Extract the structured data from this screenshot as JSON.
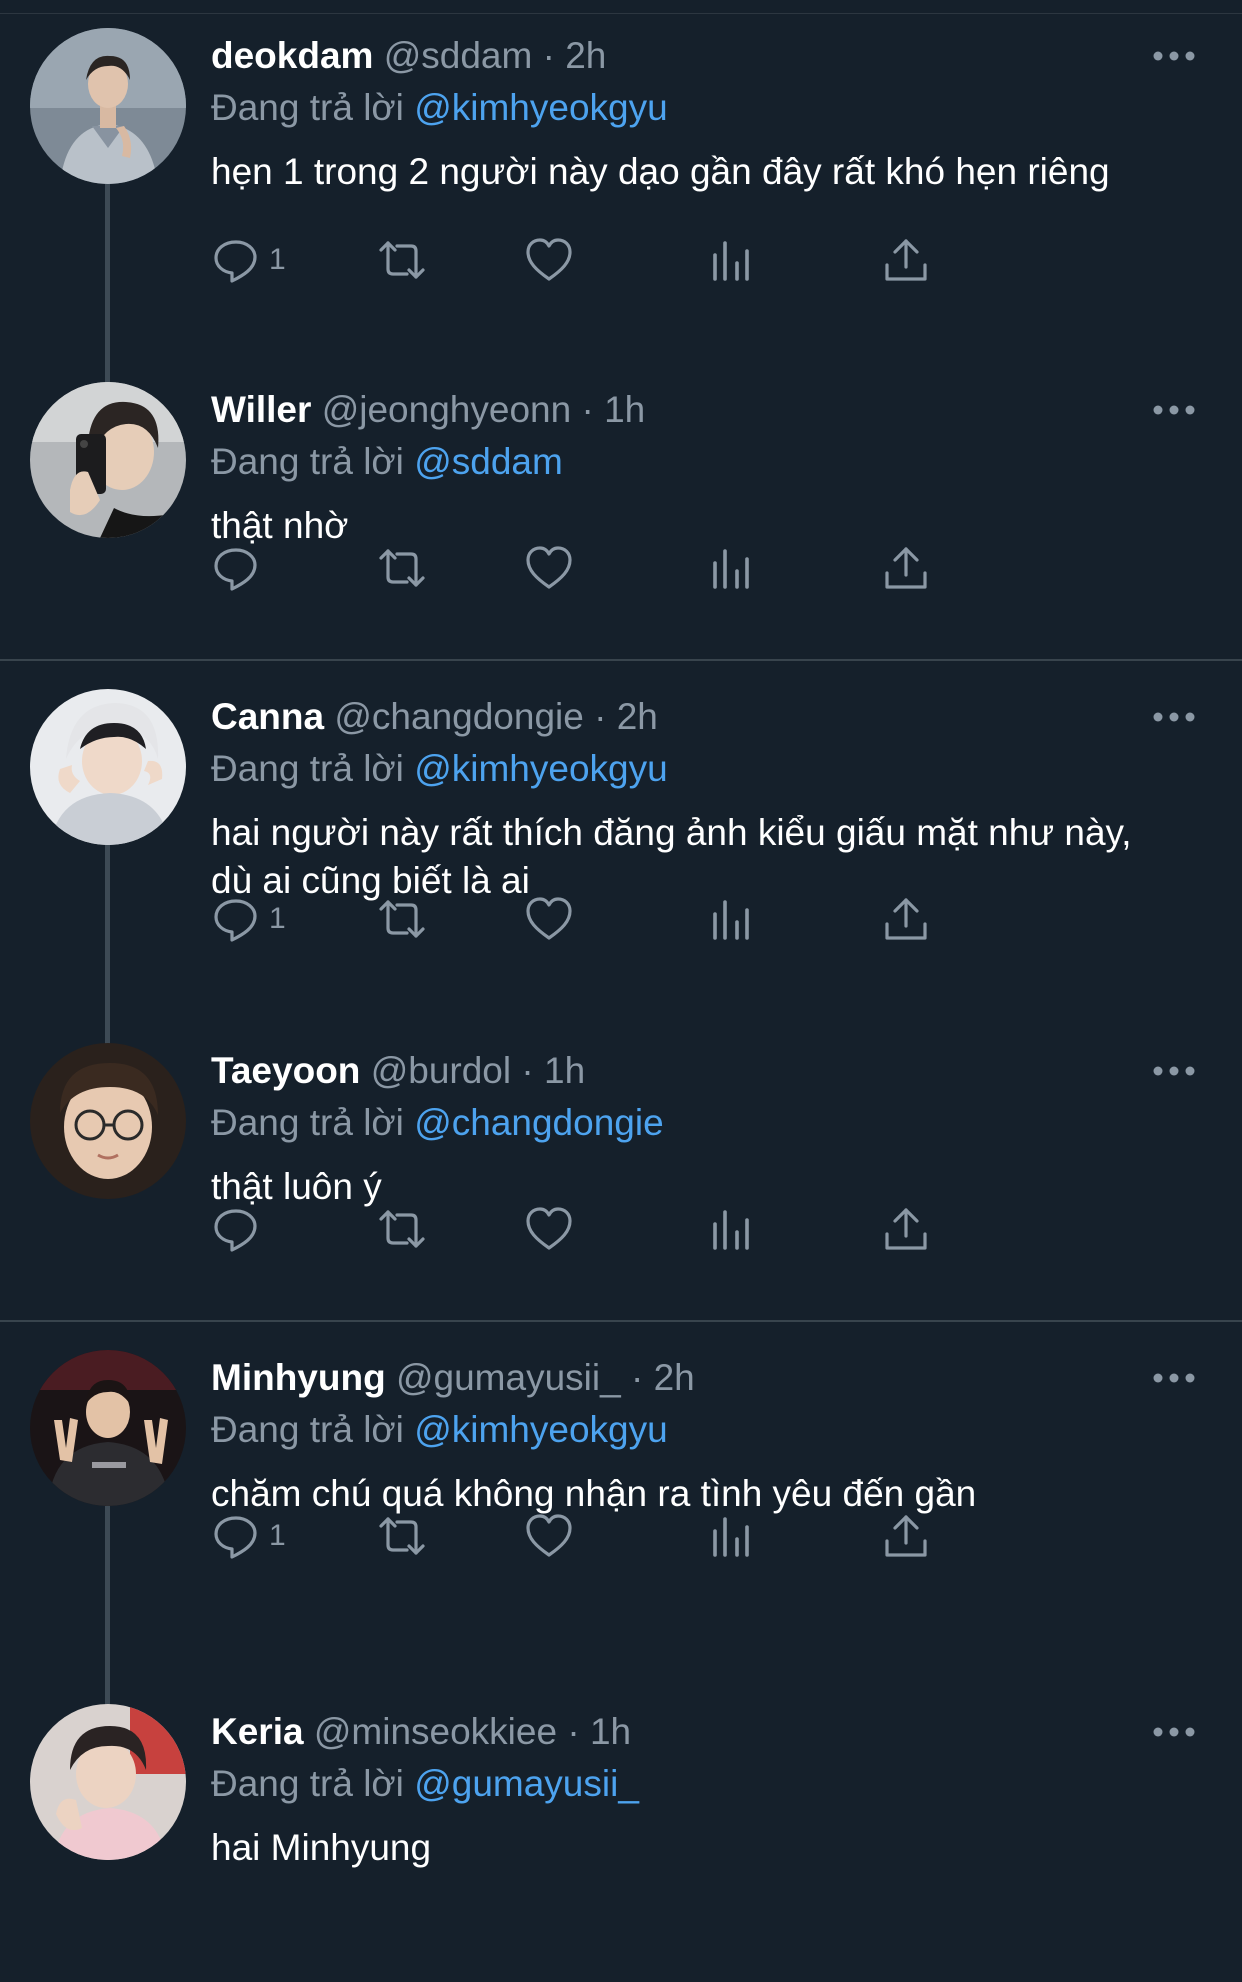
{
  "colors": {
    "background": "#15202b",
    "text": "#ffffff",
    "muted": "#8b98a5",
    "mention": "#4da3ef",
    "divider": "#38444d"
  },
  "threads": [
    {
      "tweets": [
        {
          "name": "deokdam",
          "handle": "@sddam",
          "time": "2h",
          "reply_prefix": "Đang trả lời",
          "reply_to": "@kimhyeokgyu",
          "text": "hẹn 1 trong 2 người này dạo gần đây rất khó hẹn riêng",
          "reply_count": "1"
        },
        {
          "name": "Willer",
          "handle": "@jeonghyeonn",
          "time": "1h",
          "reply_prefix": "Đang trả lời",
          "reply_to": "@sddam",
          "text": "thật nhờ",
          "reply_count": ""
        }
      ]
    },
    {
      "tweets": [
        {
          "name": "Canna",
          "handle": "@changdongie",
          "time": "2h",
          "reply_prefix": "Đang trả lời",
          "reply_to": "@kimhyeokgyu",
          "text": "hai người này rất thích đăng ảnh kiểu giấu mặt như này, dù ai cũng biết là ai",
          "reply_count": "1"
        },
        {
          "name": "Taeyoon",
          "handle": "@burdol",
          "time": "1h",
          "reply_prefix": "Đang trả lời",
          "reply_to": "@changdongie",
          "text": "thật luôn ý",
          "reply_count": ""
        }
      ]
    },
    {
      "tweets": [
        {
          "name": "Minhyung",
          "handle": "@gumayusii_",
          "time": "2h",
          "reply_prefix": "Đang trả lời",
          "reply_to": "@kimhyeokgyu",
          "text": "chăm chú quá không nhận ra tình yêu đến gần",
          "reply_count": "1"
        },
        {
          "name": "Keria",
          "handle": "@minseokkiee",
          "time": "1h",
          "reply_prefix": "Đang trả lời",
          "reply_to": "@gumayusii_",
          "text": "hai Minhyung",
          "reply_count": ""
        }
      ]
    }
  ],
  "separator": "·",
  "icons": {
    "more": "more-horizontal-icon",
    "reply": "reply-bubble-icon",
    "retweet": "retweet-icon",
    "like": "heart-icon",
    "views": "bar-chart-icon",
    "share": "share-upload-icon"
  }
}
